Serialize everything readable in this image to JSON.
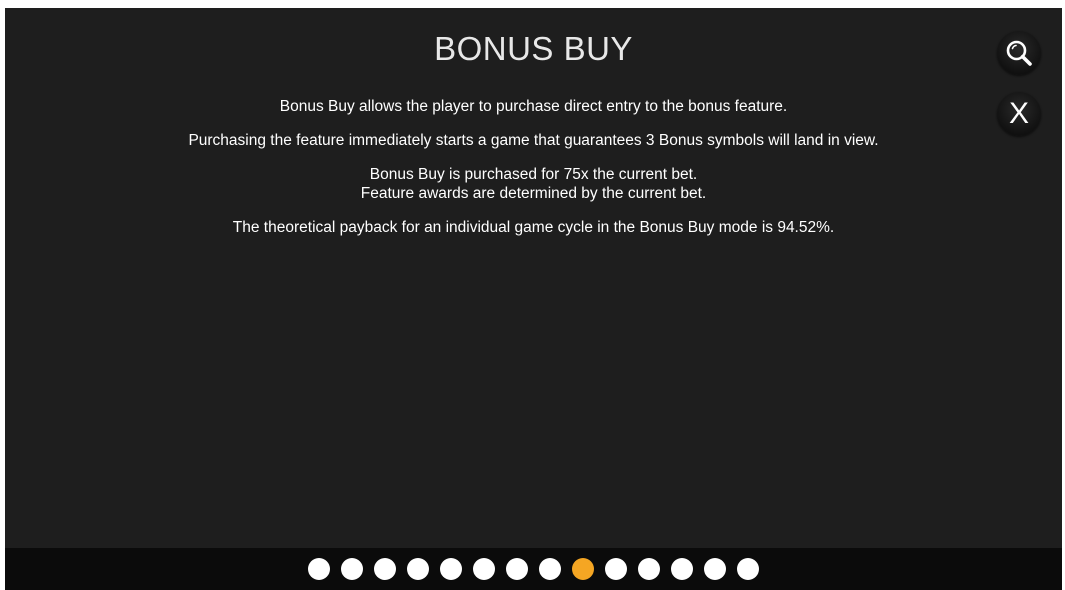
{
  "page": {
    "title": "BONUS BUY",
    "paragraphs": [
      {
        "lines": [
          "Bonus Buy allows the player to purchase direct entry to the bonus feature."
        ]
      },
      {
        "lines": [
          "Purchasing the feature immediately starts a game that guarantees 3 Bonus symbols will land in view."
        ]
      },
      {
        "lines": [
          "Bonus Buy is purchased for 75x the current bet.",
          "Feature awards are determined by the current bet."
        ]
      },
      {
        "lines": [
          "The theoretical payback for an individual game cycle in the Bonus Buy mode is 94.52%."
        ]
      }
    ]
  },
  "controls": {
    "search_icon": "magnifier-icon",
    "close_label": "X"
  },
  "pagination": {
    "total": 14,
    "current": 9,
    "dot_color": "#ffffff",
    "active_color": "#f5a623"
  },
  "colors": {
    "background": "#1e1e1e",
    "footer": "#0b0b0b",
    "text": "#ffffff"
  }
}
